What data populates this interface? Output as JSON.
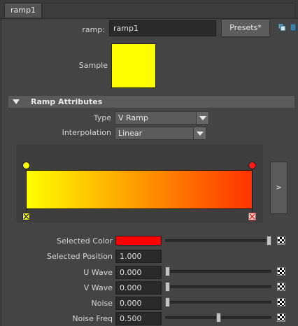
{
  "tabs": [
    {
      "label": "ramp1"
    }
  ],
  "node": {
    "label": "ramp:",
    "name": "ramp1",
    "presets_label": "Presets*"
  },
  "sample": {
    "label": "Sample",
    "color": "#ffff00"
  },
  "section": {
    "title": "Ramp Attributes"
  },
  "type": {
    "label": "Type",
    "value": "V Ramp"
  },
  "interpolation": {
    "label": "Interpolation",
    "value": "Linear"
  },
  "ramp": {
    "start_color": "#ffff00",
    "end_color": "#ff3300",
    "handles": [
      {
        "position": 0.0,
        "color": "#ffff00"
      },
      {
        "position": 1.0,
        "color": "#ff1a1a"
      }
    ],
    "expand_label": ">"
  },
  "attributes": {
    "selected_color": {
      "label": "Selected Color",
      "color": "#ff0000",
      "slider": 1.0
    },
    "selected_position": {
      "label": "Selected Position",
      "value": "1.000"
    },
    "u_wave": {
      "label": "U Wave",
      "value": "0.000",
      "slider": 0.0
    },
    "v_wave": {
      "label": "V Wave",
      "value": "0.000",
      "slider": 0.0
    },
    "noise": {
      "label": "Noise",
      "value": "0.000",
      "slider": 0.0
    },
    "noise_freq": {
      "label": "Noise Freq",
      "value": "0.500",
      "slider": 0.5
    }
  },
  "icons": {
    "copy": "copy-tab-icon",
    "map": "map-button-icon"
  },
  "colors": {
    "background": "#444444",
    "field": "#2a2a2a",
    "section": "#5a5a5a"
  }
}
